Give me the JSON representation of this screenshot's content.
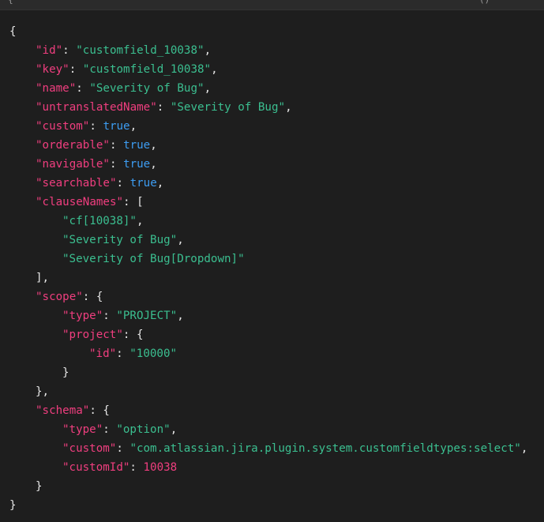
{
  "colors": {
    "background": "#1e1e1e",
    "key": "#f03e7f",
    "string": "#3bbf90",
    "boolean": "#3d9df2",
    "number": "#f03e7f",
    "punctuation": "#e6e6e6"
  },
  "topbar": {
    "left_glyph": "{",
    "right_glyph": "()"
  },
  "json": {
    "id_key": "\"id\"",
    "id_value": "\"customfield_10038\"",
    "key_key": "\"key\"",
    "key_value": "\"customfield_10038\"",
    "name_key": "\"name\"",
    "name_value": "\"Severity of Bug\"",
    "untranslated_key": "\"untranslatedName\"",
    "untranslated_value": "\"Severity of Bug\"",
    "custom_key": "\"custom\"",
    "custom_value": "true",
    "orderable_key": "\"orderable\"",
    "orderable_value": "true",
    "navigable_key": "\"navigable\"",
    "navigable_value": "true",
    "searchable_key": "\"searchable\"",
    "searchable_value": "true",
    "clause_key": "\"clauseNames\"",
    "clause_items": [
      "\"cf[10038]\"",
      "\"Severity of Bug\"",
      "\"Severity of Bug[Dropdown]\""
    ],
    "scope_key": "\"scope\"",
    "scope_type_key": "\"type\"",
    "scope_type_value": "\"PROJECT\"",
    "project_key": "\"project\"",
    "project_id_key": "\"id\"",
    "project_id_value": "\"10000\"",
    "schema_key": "\"schema\"",
    "schema_type_key": "\"type\"",
    "schema_type_value": "\"option\"",
    "schema_custom_key": "\"custom\"",
    "schema_custom_value": "\"com.atlassian.jira.plugin.system.customfieldtypes:select\"",
    "schema_customid_key": "\"customId\"",
    "schema_customid_value": "10038"
  }
}
